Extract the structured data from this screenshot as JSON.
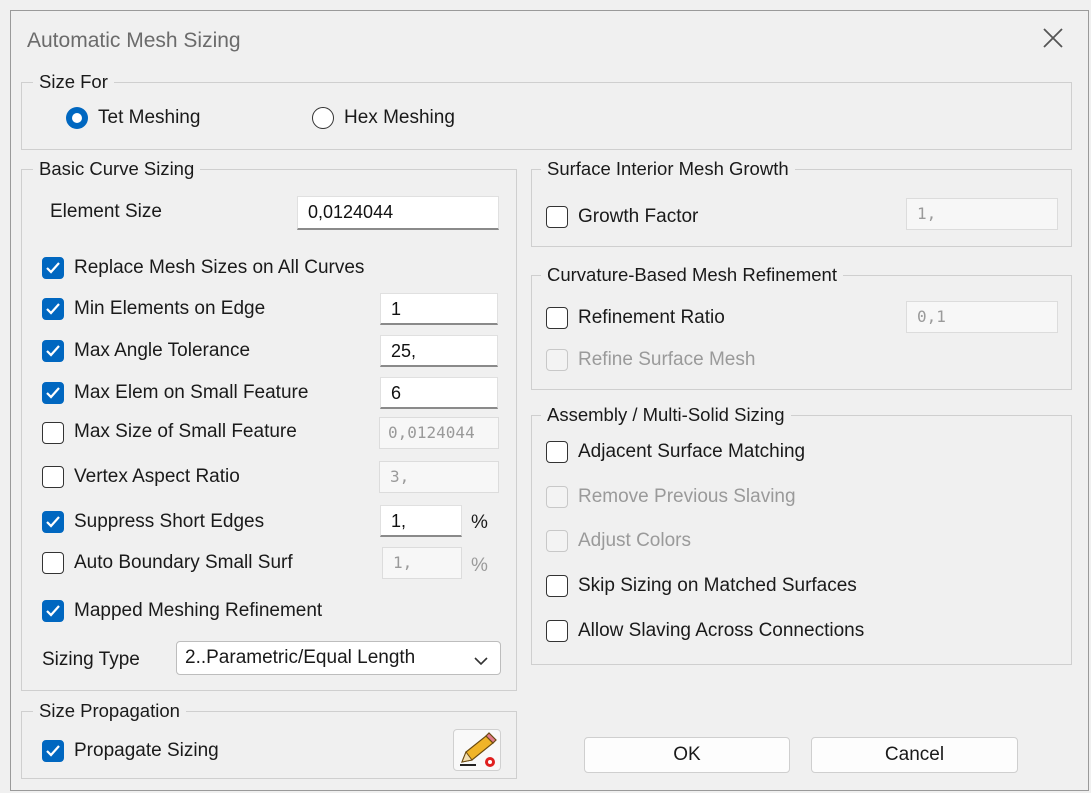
{
  "window": {
    "title": "Automatic Mesh Sizing"
  },
  "size_for": {
    "label": "Size For",
    "tet": "Tet Meshing",
    "hex": "Hex Meshing",
    "selected": "tet"
  },
  "basic": {
    "label": "Basic Curve Sizing",
    "element_size_label": "Element Size",
    "element_size_value": "0,0124044",
    "replace": "Replace Mesh Sizes on All Curves",
    "min_edge": "Min Elements on Edge",
    "min_edge_value": "1",
    "max_angle": "Max Angle Tolerance",
    "max_angle_value": "25,",
    "max_elem": "Max Elem on Small Feature",
    "max_elem_value": "6",
    "max_size": "Max Size of Small Feature",
    "max_size_value": "0,0124044",
    "vertex": "Vertex Aspect Ratio",
    "vertex_value": "3,",
    "suppress": "Suppress Short Edges",
    "suppress_value": "1,",
    "suppress_unit": "%",
    "auto_boundary": "Auto Boundary Small Surf",
    "auto_boundary_value": "1,",
    "auto_boundary_unit": "%",
    "mapped": "Mapped Meshing Refinement",
    "sizing_type_label": "Sizing Type",
    "sizing_type_value": "2..Parametric/Equal Length"
  },
  "growth": {
    "label": "Surface Interior Mesh Growth",
    "factor": "Growth Factor",
    "factor_value": "1,"
  },
  "curvature": {
    "label": "Curvature-Based Mesh Refinement",
    "ratio": "Refinement Ratio",
    "ratio_value": "0,1",
    "refine": "Refine Surface Mesh"
  },
  "assembly": {
    "label": "Assembly / Multi-Solid Sizing",
    "adjacent": "Adjacent Surface Matching",
    "remove": "Remove Previous Slaving",
    "adjust": "Adjust Colors",
    "skip": "Skip Sizing on Matched Surfaces",
    "allow": "Allow Slaving Across Connections"
  },
  "propagation": {
    "label": "Size Propagation",
    "propagate": "Propagate Sizing"
  },
  "buttons": {
    "ok": "OK",
    "cancel": "Cancel"
  },
  "colors": {
    "accent": "#0067c0",
    "background": "#f0f0f0",
    "disabled_text": "#9a9a9a"
  }
}
